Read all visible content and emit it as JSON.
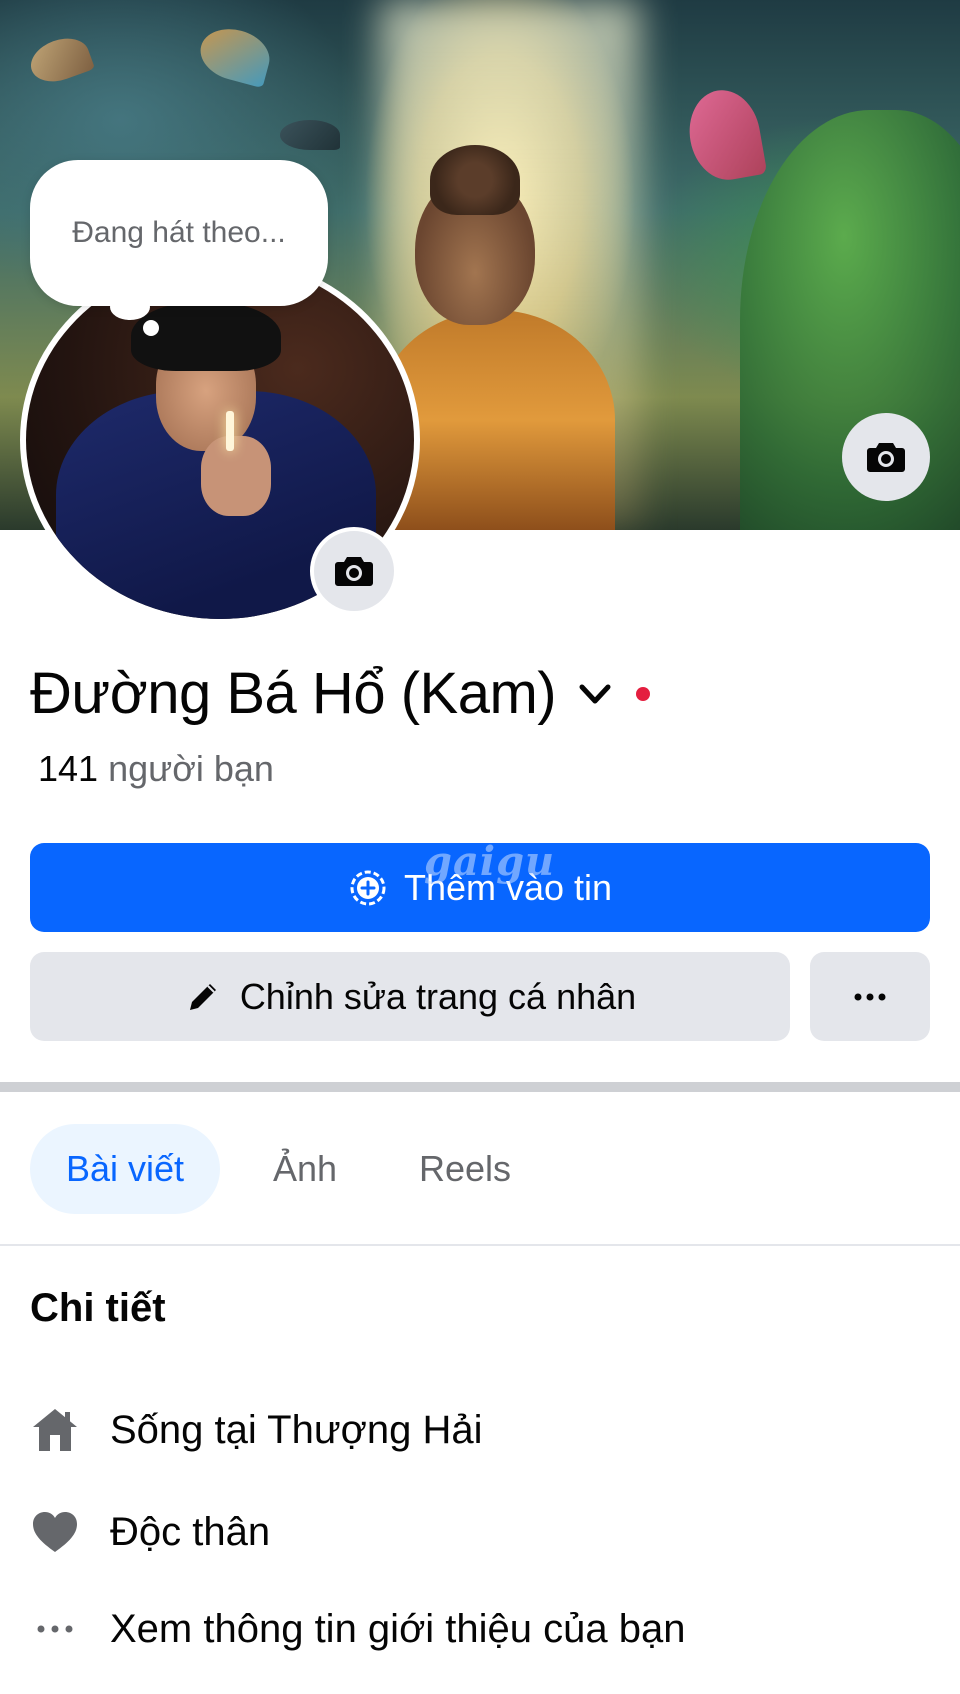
{
  "profile": {
    "bubble_text": "Đang hát theo...",
    "name": "Đường Bá Hổ (Kam)",
    "friends_count": "141",
    "friends_label": "người bạn"
  },
  "actions": {
    "add_story_label": "Thêm vào tin",
    "edit_profile_label": "Chỉnh sửa trang cá nhân",
    "more_label": "···"
  },
  "tabs": [
    {
      "label": "Bài viết",
      "active": true
    },
    {
      "label": "Ảnh",
      "active": false
    },
    {
      "label": "Reels",
      "active": false
    }
  ],
  "details": {
    "title": "Chi tiết",
    "items": [
      {
        "icon": "home-icon",
        "text": "Sống tại Thượng Hải"
      },
      {
        "icon": "heart-icon",
        "text": "Độc thân"
      },
      {
        "icon": "more-horizontal-icon",
        "text": "Xem thông tin giới thiệu của bạn"
      }
    ]
  },
  "watermark": "gaigu",
  "colors": {
    "primary": "#0866ff",
    "secondary_bg": "#e4e6eb",
    "tab_active_bg": "#ebf5ff",
    "muted_text": "#65676b",
    "status_dot": "#e41e3f"
  }
}
